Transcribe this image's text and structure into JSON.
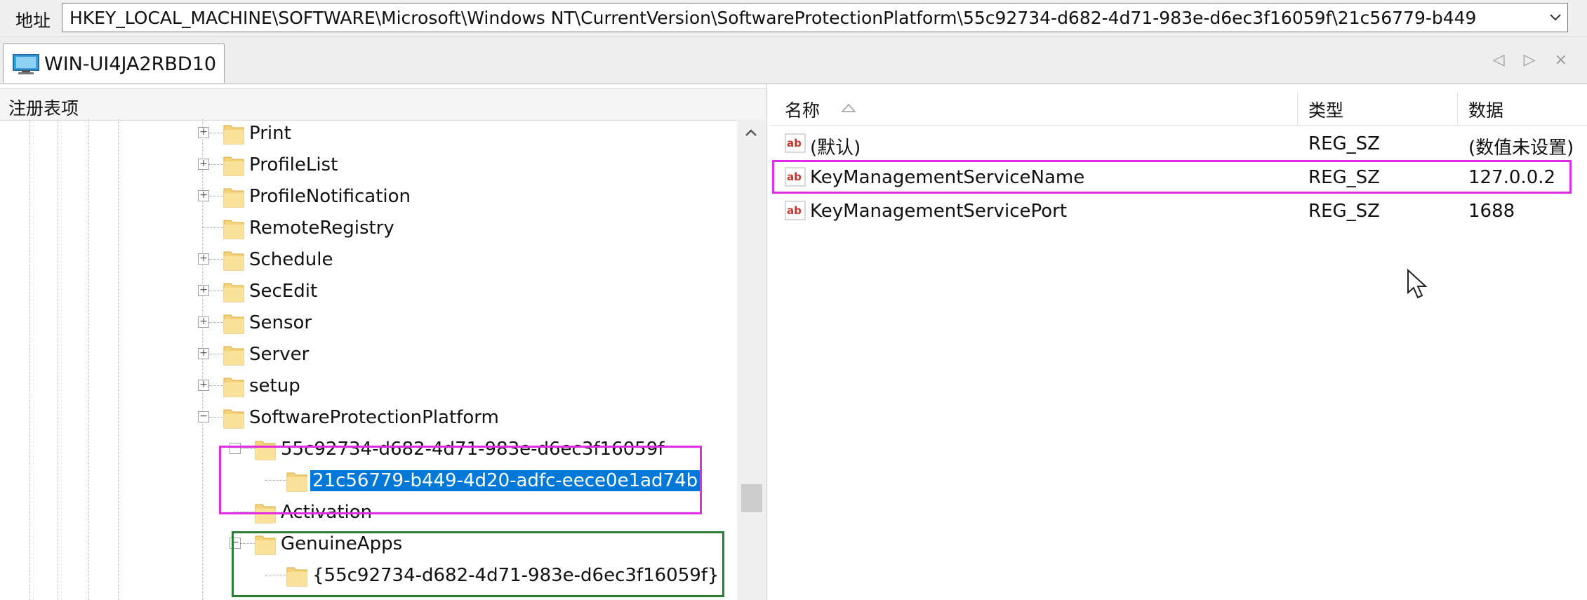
{
  "address_bar": {
    "label": "地址",
    "path": "HKEY_LOCAL_MACHINE\\SOFTWARE\\Microsoft\\Windows NT\\CurrentVersion\\SoftwareProtectionPlatform\\55c92734-d682-4d71-983e-d6ec3f16059f\\21c56779-b449"
  },
  "tab": {
    "label": "WIN-UI4JA2RBD10",
    "icon": "computer-icon"
  },
  "tab_nav": {
    "prev": "◁",
    "next": "▷",
    "close": "×"
  },
  "left_pane": {
    "header": "注册表项",
    "tree": [
      {
        "label": "Print",
        "expander": "+",
        "selected": false
      },
      {
        "label": "ProfileList",
        "expander": "+",
        "selected": false
      },
      {
        "label": "ProfileNotification",
        "expander": "+",
        "selected": false
      },
      {
        "label": "RemoteRegistry",
        "expander": "",
        "selected": false
      },
      {
        "label": "Schedule",
        "expander": "+",
        "selected": false
      },
      {
        "label": "SecEdit",
        "expander": "+",
        "selected": false
      },
      {
        "label": "Sensor",
        "expander": "+",
        "selected": false
      },
      {
        "label": "Server",
        "expander": "+",
        "selected": false
      },
      {
        "label": "setup",
        "expander": "+",
        "selected": false
      },
      {
        "label": "SoftwareProtectionPlatform",
        "expander": "−",
        "selected": false
      },
      {
        "label": "55c92734-d682-4d71-983e-d6ec3f16059f",
        "expander": "−",
        "selected": false
      },
      {
        "label": "21c56779-b449-4d20-adfc-eece0e1ad74b",
        "expander": "",
        "selected": true
      },
      {
        "label": "Activation",
        "expander": "",
        "selected": false
      },
      {
        "label": "GenuineApps",
        "expander": "−",
        "selected": false
      },
      {
        "label": "{55c92734-d682-4d71-983e-d6ec3f16059f}",
        "expander": "",
        "selected": false
      }
    ]
  },
  "right_pane": {
    "columns": {
      "name": "名称",
      "type": "类型",
      "data": "数据"
    },
    "sort_icon": "sort-ascending-icon",
    "rows": [
      {
        "icon": "string-value-icon",
        "name": "(默认)",
        "type": "REG_SZ",
        "data": "(数值未设置)"
      },
      {
        "icon": "string-value-icon",
        "name": "KeyManagementServiceName",
        "type": "REG_SZ",
        "data": "127.0.0.2"
      },
      {
        "icon": "string-value-icon",
        "name": "KeyManagementServicePort",
        "type": "REG_SZ",
        "data": "1688"
      }
    ]
  },
  "colors": {
    "selection": "#0078d7",
    "highlight_magenta": "#e22be2",
    "highlight_green": "#2e7d32",
    "folder": "#f5d37a"
  }
}
